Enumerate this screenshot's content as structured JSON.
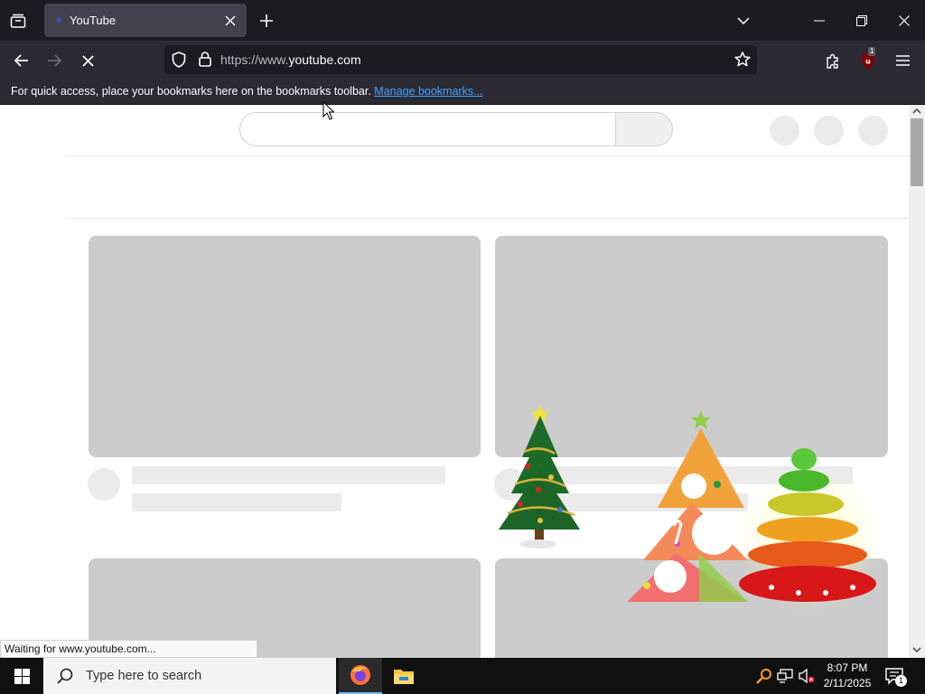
{
  "browser": {
    "tab_title": "YouTube",
    "url_prefix": "https://www.",
    "url_host": "youtube.com",
    "extension_badge": "1",
    "bookmarks_message": "For quick access, place your bookmarks here on the bookmarks toolbar.",
    "manage_bookmarks_link": "Manage bookmarks..."
  },
  "status_bar": {
    "text": "Waiting for www.youtube.com..."
  },
  "taskbar": {
    "search_placeholder": "Type here to search",
    "time": "8:07 PM",
    "date": "2/11/2025",
    "notification_count": "1"
  },
  "icons": {
    "tab_list": "tab-list-icon",
    "back": "arrow-left-icon",
    "forward": "arrow-right-icon",
    "stop": "close-icon",
    "tracking": "shield-icon",
    "lock": "lock-icon",
    "bookmark": "star-icon",
    "extensions": "puzzle-icon",
    "menu": "hamburger-icon"
  },
  "colors": {
    "chrome_dark": "#1c1b22",
    "toolbar": "#2b2a33",
    "link": "#45a1ff",
    "skeleton": "#cccccc"
  }
}
